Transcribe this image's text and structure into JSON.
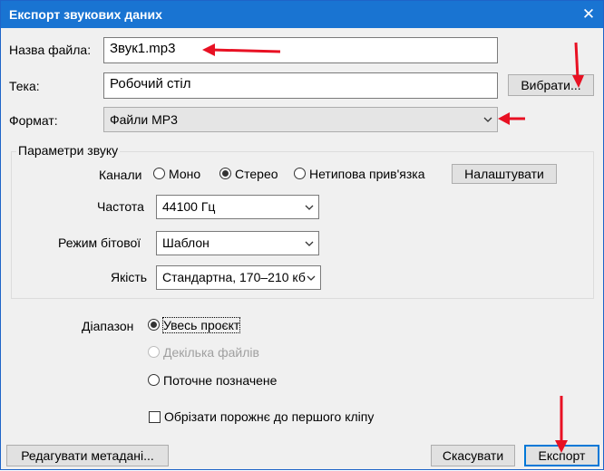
{
  "window": {
    "title": "Експорт звукових даних",
    "close_glyph": "✕"
  },
  "file_name": {
    "label": "Назва файла:",
    "value": "Звук1.mp3"
  },
  "folder": {
    "label": "Тека:",
    "value": "Робочий стіл",
    "browse_label": "Вибрати..."
  },
  "format": {
    "label": "Формат:",
    "value": "Файли MP3"
  },
  "sound_params": {
    "title": "Параметри звуку",
    "channels": {
      "label": "Канали",
      "options": [
        "Моно",
        "Стерео",
        "Нетипова прив'язка"
      ],
      "selected": "Стерео",
      "configure_label": "Налаштувати"
    },
    "frequency": {
      "label": "Частота",
      "value": "44100 Гц"
    },
    "bitrate_mode": {
      "label": "Режим бітової",
      "value": "Шаблон"
    },
    "quality": {
      "label": "Якість",
      "value": "Стандартна, 170–210 кб"
    }
  },
  "range": {
    "label": "Діапазон",
    "options": [
      "Увесь проєкт",
      "Декілька файлів",
      "Поточне позначене"
    ],
    "selected": "Увесь проєкт",
    "disabled": [
      "Декілька файлів"
    ]
  },
  "trim": {
    "label": "Обрізати порожнє до першого кліпу",
    "checked": false
  },
  "buttons": {
    "edit_metadata": "Редагувати метадані...",
    "cancel": "Скасувати",
    "export": "Експорт"
  },
  "colors": {
    "titlebar": "#1974d2",
    "annotation_arrow": "#e81123",
    "focus_border": "#0078d7"
  }
}
